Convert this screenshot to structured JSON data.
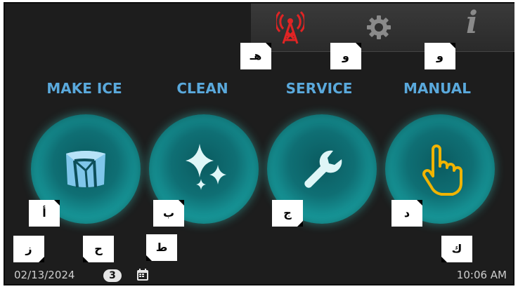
{
  "topbar": {
    "icons": [
      "signal-tower-icon",
      "gear-icon",
      "info-icon"
    ],
    "info_glyph": "i"
  },
  "menu": {
    "items": [
      {
        "label": "MAKE ICE",
        "icon": "ice-cube-icon",
        "tag": "أ"
      },
      {
        "label": "CLEAN",
        "icon": "sparkle-icon",
        "tag": "ب"
      },
      {
        "label": "SERVICE",
        "icon": "wrench-icon",
        "tag": "ج"
      },
      {
        "label": "MANUAL",
        "icon": "hand-pointer-icon",
        "tag": "د"
      }
    ]
  },
  "tags": {
    "signal": "هـ",
    "gear": "و",
    "info": "و",
    "date": "ز",
    "badge": "ح",
    "calendar": "ط",
    "time": "ك"
  },
  "status": {
    "date": "02/13/2024",
    "badge_count": "3",
    "time": "10:06 AM"
  },
  "colors": {
    "accent_label": "#5aa9dc",
    "signal_red": "#e02424",
    "hand_yellow": "#f0b400",
    "circle_teal": "#19a2a3"
  }
}
